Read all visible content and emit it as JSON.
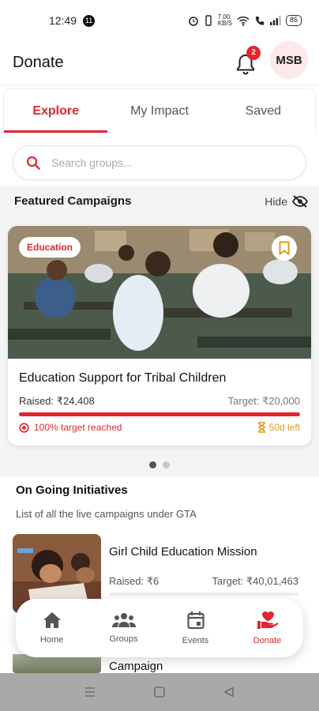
{
  "status_bar": {
    "time": "12:49",
    "notification_count": "11",
    "net_speed_top": "7.00",
    "net_speed_bottom": "KB/S",
    "battery": "85"
  },
  "header": {
    "title": "Donate",
    "notification_badge": "2",
    "avatar_initials": "MSB"
  },
  "tabs": [
    {
      "label": "Explore",
      "active": true
    },
    {
      "label": "My Impact",
      "active": false
    },
    {
      "label": "Saved",
      "active": false
    }
  ],
  "search": {
    "placeholder": "Search groups..."
  },
  "featured": {
    "label": "Featured Campaigns",
    "hide_label": "Hide",
    "card": {
      "tag": "Education",
      "title": "Education Support for Tribal Children",
      "raised": "Raised: ₹24,408",
      "target": "Target: ₹20,000",
      "progress": 1.0,
      "reached": "100% target reached",
      "days_left": "50d left"
    },
    "pager": {
      "count": 2,
      "active_index": 0
    }
  },
  "ongoing": {
    "title": "On Going Initiatives",
    "subtitle": "List of all the live campaigns under GTA",
    "items": [
      {
        "title": "Girl Child Education Mission",
        "raised": "Raised: ₹6",
        "target": "Target: ₹40,01,463"
      },
      {
        "title": "Campaign"
      }
    ]
  },
  "bottom_nav": [
    {
      "label": "Home",
      "icon": "home-icon"
    },
    {
      "label": "Groups",
      "icon": "groups-icon"
    },
    {
      "label": "Events",
      "icon": "calendar-icon"
    },
    {
      "label": "Donate",
      "icon": "donate-icon",
      "active": true
    }
  ],
  "colors": {
    "accent": "#e3262e",
    "days_left": "#d99c1b"
  }
}
